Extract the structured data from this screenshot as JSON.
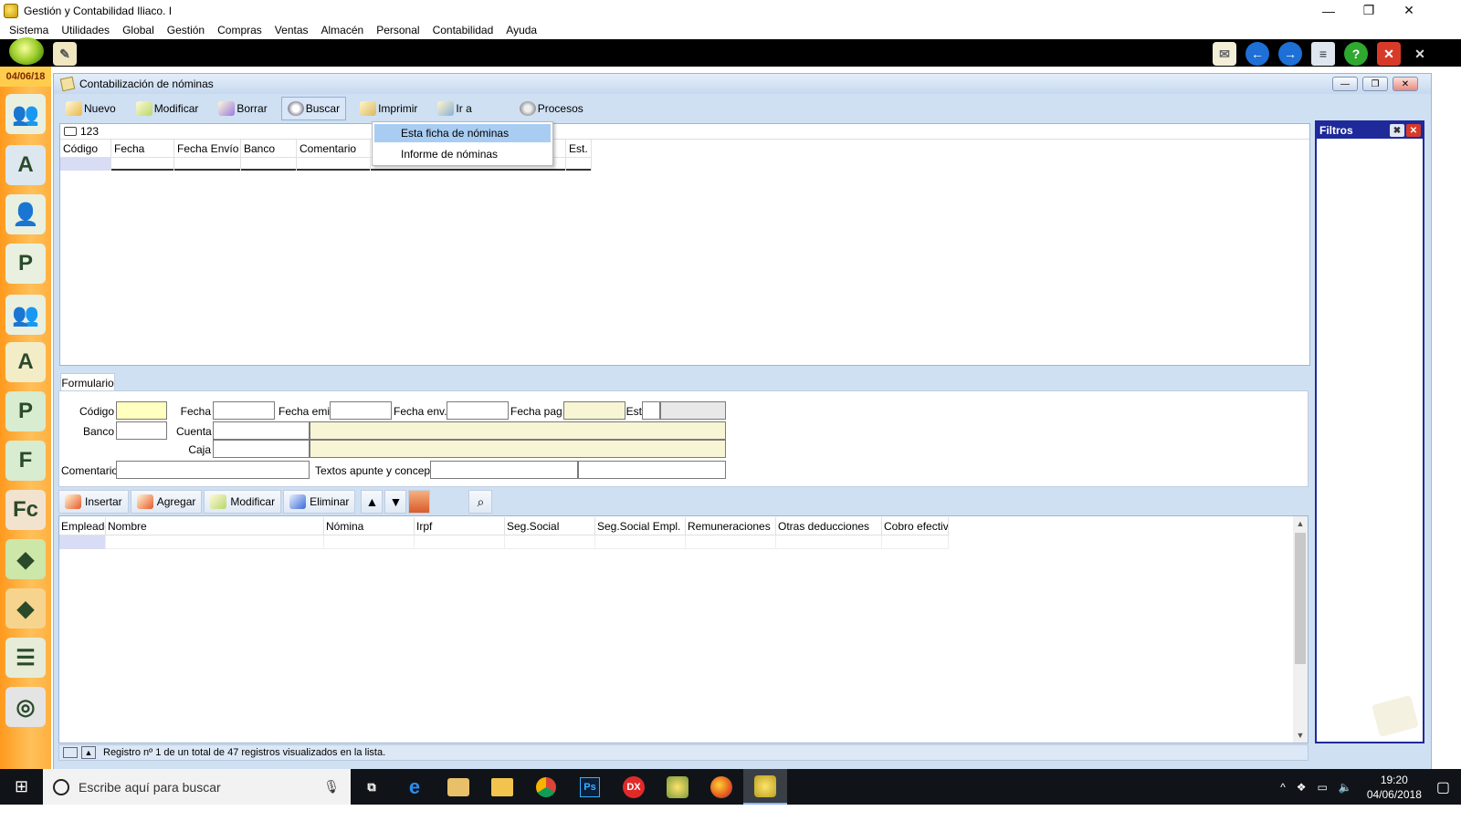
{
  "window": {
    "title": "Gestión y Contabilidad Iliaco. I",
    "minimize": "—",
    "restore": "❐",
    "close": "✕"
  },
  "menubar": [
    "Sistema",
    "Utilidades",
    "Global",
    "Gestión",
    "Compras",
    "Ventas",
    "Almacén",
    "Personal",
    "Contabilidad",
    "Ayuda"
  ],
  "sidebar": {
    "date": "04/06/18",
    "icons": [
      "users-icon",
      "accounts-icon",
      "person-icon",
      "person-p-icon",
      "group-icon",
      "person-a-icon",
      "p-doc-icon",
      "f-doc-icon",
      "fc-doc-icon",
      "bag-green-icon",
      "bag-orange-icon",
      "ledger-icon",
      "disc-icon"
    ]
  },
  "inner": {
    "title": "Contabilización de nóminas",
    "toolbar": {
      "nuevo": "Nuevo",
      "modificar": "Modificar",
      "borrar": "Borrar",
      "buscar": "Buscar",
      "imprimir": "Imprimir",
      "ir_a": "Ir a",
      "procesos": "Procesos"
    },
    "search_value": "123",
    "grid_columns": [
      "Código",
      "Fecha",
      "Fecha Envío",
      "Banco",
      "Comentario",
      "",
      "Est."
    ],
    "dropdown": [
      "Esta ficha de nóminas",
      "Informe de nóminas"
    ],
    "filters_title": "Filtros"
  },
  "form": {
    "tab": "Formulario",
    "labels": {
      "codigo": "Código",
      "fecha": "Fecha",
      "fecha_emi": "Fecha emi.",
      "fecha_env": "Fecha env.",
      "fecha_pag": "Fecha pag.",
      "est": "Est",
      "banco": "Banco",
      "cuenta": "Cuenta",
      "caja": "Caja",
      "comentario": "Comentario",
      "textos": "Textos apunte y concepto"
    }
  },
  "detail": {
    "insertar": "Insertar",
    "agregar": "Agregar",
    "modificar": "Modificar",
    "eliminar": "Eliminar",
    "up": "▲",
    "down": "▼",
    "columns": [
      "Empleado",
      "Nombre",
      "Nómina",
      "Irpf",
      "Seg.Social",
      "Seg.Social Empl.",
      "Remuneraciones",
      "Otras deducciones",
      "Cobro efectivo"
    ]
  },
  "status": {
    "text": "Registro nº 1 de un total de 47 registros visualizados en la lista."
  },
  "taskbar": {
    "search_placeholder": "Escribe aquí para buscar",
    "apps": [
      "task-view-icon",
      "edge-icon",
      "mail-icon",
      "explorer-icon",
      "chrome-icon",
      "photoshop-icon",
      "dx-icon",
      "app-icon",
      "firefox-icon",
      "iliaco-icon"
    ],
    "app_labels": {
      "photoshop": "Ps",
      "dx": "DX",
      "edge": "e"
    },
    "time": "19:20",
    "date": "04/06/2018"
  },
  "colors": {
    "accent_blue": "#1e2a9a",
    "sidebar_orange": "#ff9a1e",
    "inner_bg": "#cfe0f3",
    "field_yellow": "#ffffc0"
  }
}
